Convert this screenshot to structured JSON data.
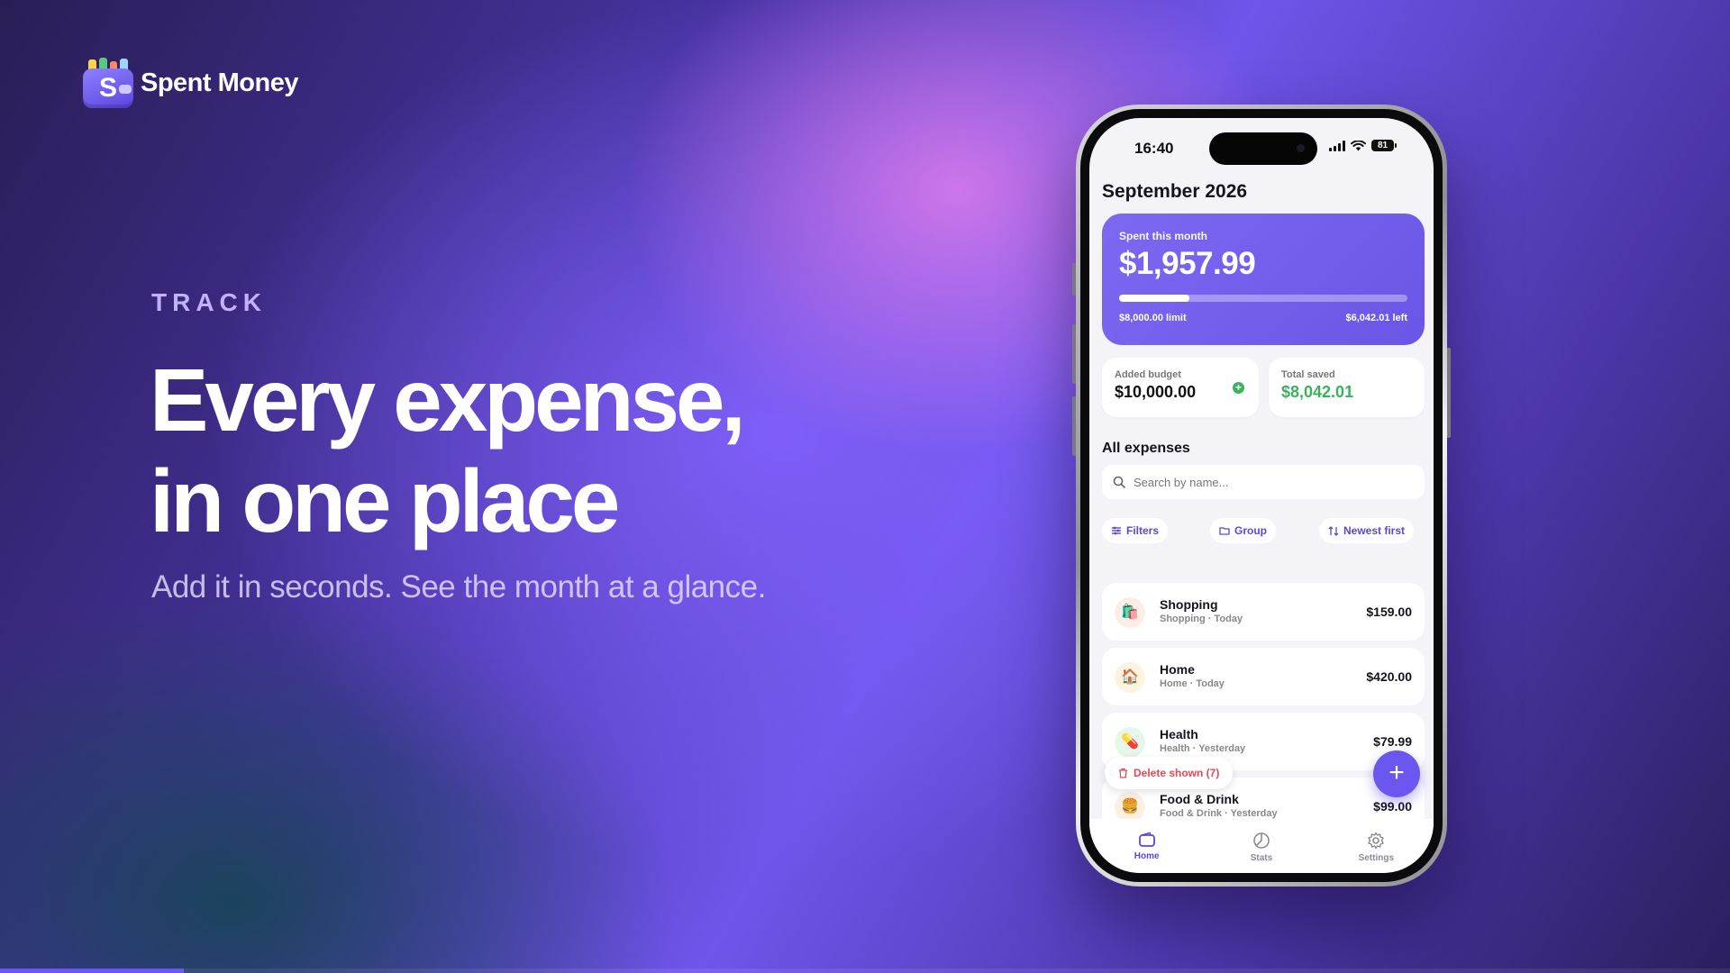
{
  "brand": {
    "name": "Spent Money",
    "logo_letter": "S",
    "logo_cards": [
      "#ffd54a",
      "#59c97a",
      "#ff8a65",
      "#9fd6ff"
    ]
  },
  "hero": {
    "eyebrow": "TRACK",
    "headline": [
      "Every expense,",
      "in one place"
    ],
    "subline": "Add it in seconds. See the month at a glance."
  },
  "slide_progress": {
    "fraction": 0.106,
    "color": "#6b57f5"
  },
  "phone": {
    "status": {
      "time": "16:40",
      "battery": "81"
    },
    "month_title": "September 2026",
    "spent_card": {
      "label": "Spent this month",
      "amount": "$1,957.99",
      "limit": "$8,000.00 limit",
      "left": "$6,042.01 left",
      "progress_fraction": 0.245
    },
    "added_budget": {
      "label": "Added budget",
      "value": "$10,000.00"
    },
    "total_saved": {
      "label": "Total saved",
      "value": "$8,042.01"
    },
    "expenses_title": "All expenses",
    "search_placeholder": "Search by name...",
    "chips": {
      "filters": "Filters",
      "group": "Group",
      "sort": "Newest first"
    },
    "expenses": [
      {
        "name": "Shopping",
        "meta": "Shopping · Today",
        "amount": "$159.00",
        "emoji": "🛍️",
        "tint": "#fbeee6"
      },
      {
        "name": "Home",
        "meta": "Home · Today",
        "amount": "$420.00",
        "emoji": "🏠",
        "tint": "#fdf3df"
      },
      {
        "name": "Health",
        "meta": "Health · Yesterday",
        "amount": "$79.99",
        "emoji": "💊",
        "tint": "#e6f6ea"
      },
      {
        "name": "Food & Drink",
        "meta": "Food & Drink · Yesterday",
        "amount": "$99.00",
        "emoji": "🍔",
        "tint": "#fdefe2"
      }
    ],
    "delete_label": "Delete shown (7)",
    "fab_label": "+",
    "tabs": {
      "home": "Home",
      "stats": "Stats",
      "settings": "Settings"
    },
    "colors": {
      "accent": "#6b56f0",
      "green": "#3ab25c",
      "danger": "#e04a5a"
    }
  }
}
